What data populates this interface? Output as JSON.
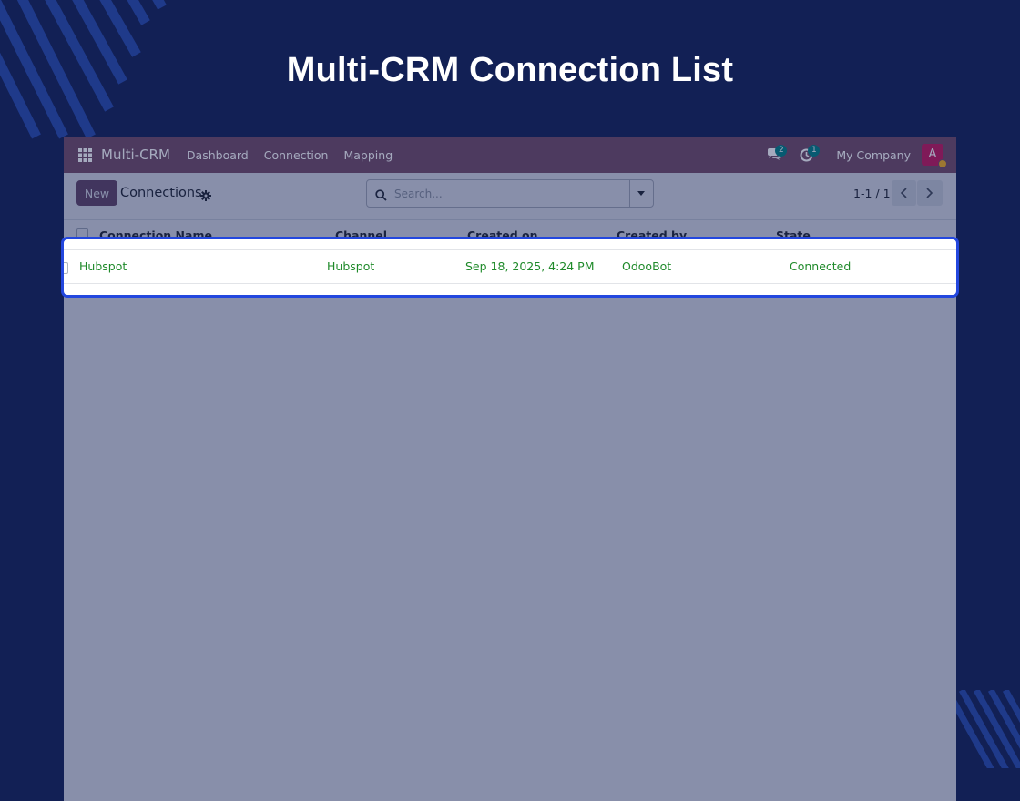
{
  "banner": {
    "title": "Multi-CRM Connection List"
  },
  "navbar": {
    "brand": "Multi-CRM",
    "menu": [
      "Dashboard",
      "Connection",
      "Mapping"
    ],
    "messages_badge": "2",
    "activities_badge": "1",
    "company": "My Company",
    "avatar_initial": "A"
  },
  "control_panel": {
    "new_label": "New",
    "breadcrumb": "Connections",
    "search_placeholder": "Search...",
    "pager": "1-1 / 1"
  },
  "table": {
    "columns": [
      "Connection Name",
      "Channel",
      "Created on",
      "Created by",
      "State"
    ],
    "rows": [
      [
        "Hubspot",
        "Hubspot",
        "Sep 18, 2025, 4:24 PM",
        "OdooBot",
        "Connected"
      ]
    ]
  },
  "colors": {
    "background": "#122055",
    "navbar": "#714b67",
    "highlight_border": "#2347de",
    "state_text": "#1f8a2a"
  },
  "icons": [
    "apps-grid-icon",
    "chat-icon",
    "clock-icon",
    "gear-icon",
    "search-icon",
    "caret-down-icon",
    "chevron-left-icon",
    "chevron-right-icon"
  ]
}
